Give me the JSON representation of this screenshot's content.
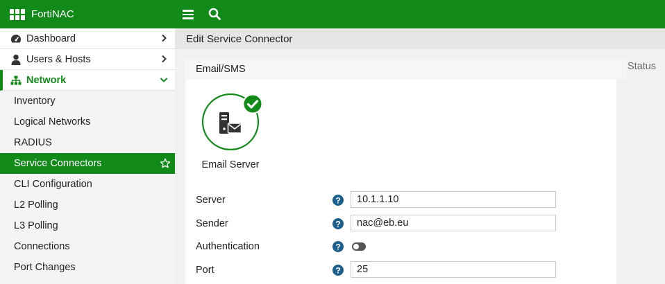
{
  "topbar": {
    "brand": "FortiNAC",
    "icons": [
      "menu-icon",
      "search-icon"
    ],
    "color": "#118a19"
  },
  "sidebar": {
    "top_items": [
      {
        "label": "Dashboard",
        "icon": "dashboard-icon"
      },
      {
        "label": "Users & Hosts",
        "icon": "user-icon"
      },
      {
        "label": "Network",
        "icon": "network-icon",
        "expanded": true
      }
    ],
    "sub_items": [
      {
        "label": "Inventory"
      },
      {
        "label": "Logical Networks"
      },
      {
        "label": "RADIUS"
      },
      {
        "label": "Service Connectors",
        "selected": true
      },
      {
        "label": "CLI Configuration"
      },
      {
        "label": "L2 Polling"
      },
      {
        "label": "L3 Polling"
      },
      {
        "label": "Connections"
      },
      {
        "label": "Port Changes"
      }
    ]
  },
  "content": {
    "page_title": "Edit Service Connector",
    "tab": "Email/SMS",
    "status_label": "Status",
    "connector": {
      "name": "Email Server",
      "icon": "email-server-icon",
      "status_icon": "check-icon"
    },
    "form": {
      "server": {
        "label": "Server",
        "value": "10.1.1.10"
      },
      "sender": {
        "label": "Sender",
        "value": "nac@eb.eu"
      },
      "authentication": {
        "label": "Authentication",
        "enabled": false
      },
      "port": {
        "label": "Port",
        "value": "25"
      }
    }
  }
}
